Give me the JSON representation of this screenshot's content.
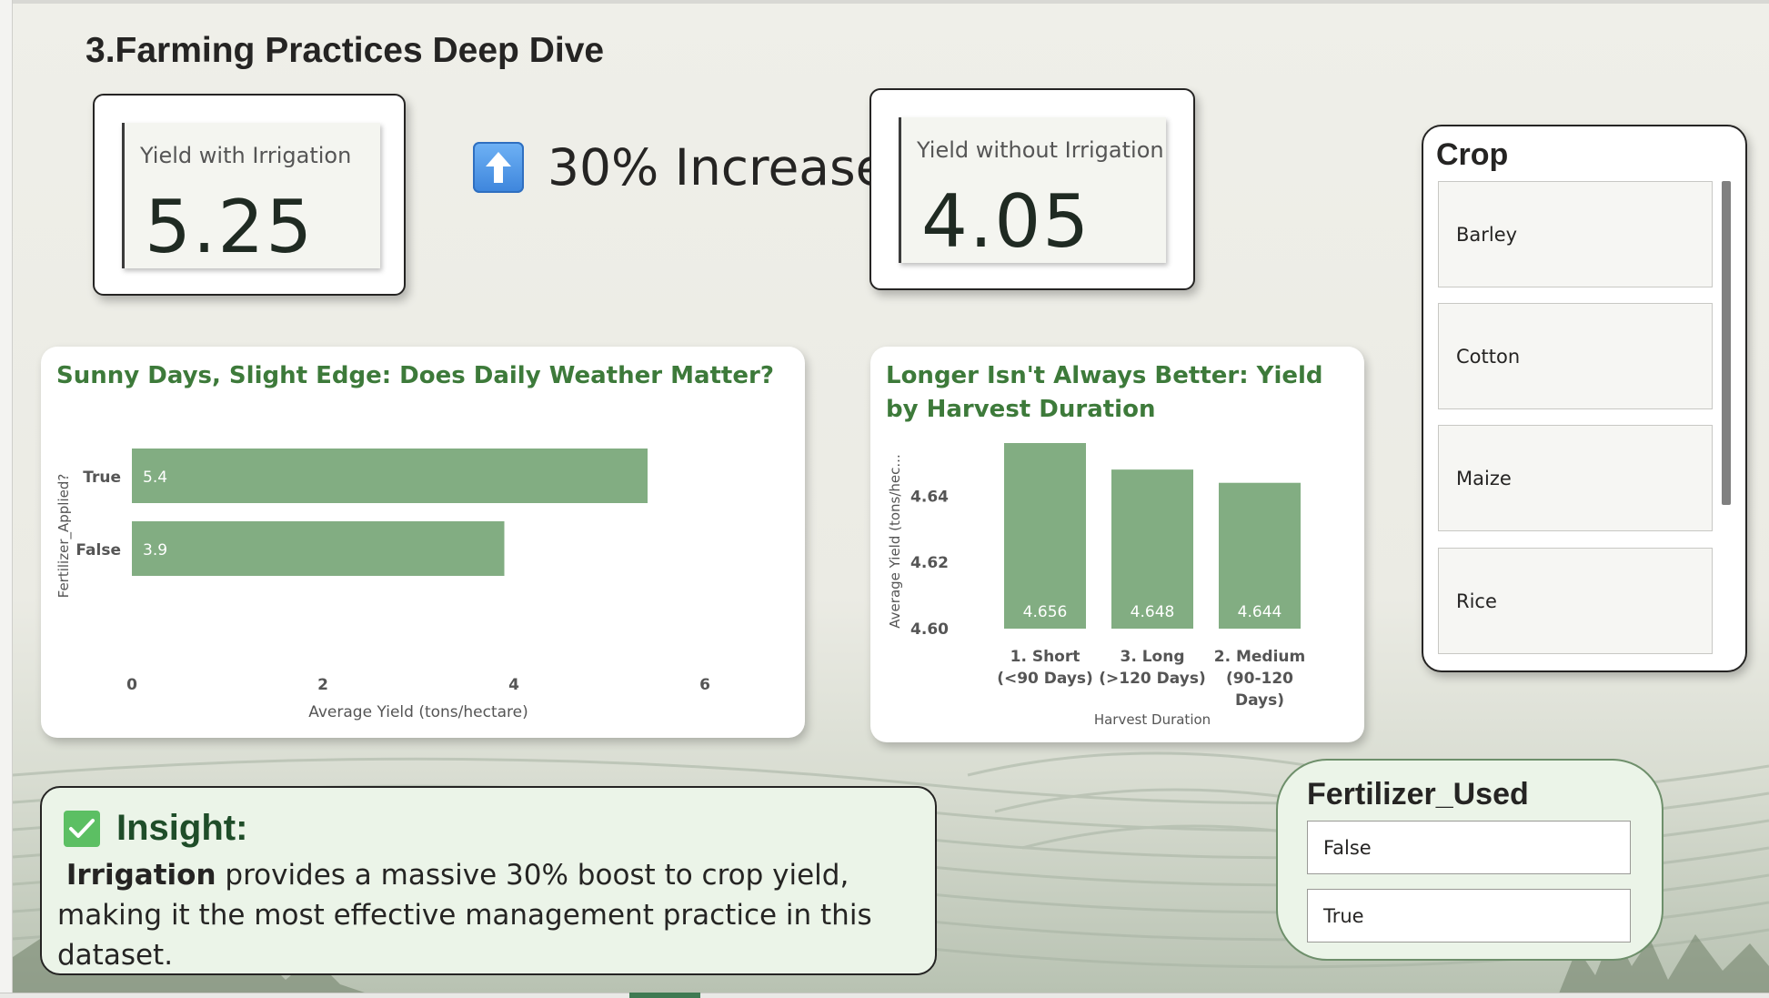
{
  "page": {
    "title": "3.Farming Practices Deep Dive"
  },
  "kpis": {
    "with_irrigation": {
      "label": "Yield with Irrigation",
      "value": "5.25"
    },
    "without_irrigation": {
      "label": "Yield without Irrigation",
      "value": "4.05"
    },
    "increase": {
      "text": "30% Increase",
      "icon": "up-arrow-icon"
    }
  },
  "chart_data": [
    {
      "type": "bar",
      "orientation": "horizontal",
      "title": "Sunny Days, Slight Edge: Does Daily Weather Matter?",
      "xlabel": "Average Yield (tons/hectare)",
      "ylabel": "Fertilizer_Applied?",
      "categories": [
        "True",
        "False"
      ],
      "values": [
        5.4,
        3.9
      ],
      "data_labels": [
        "5.4",
        "3.9"
      ],
      "xlim": [
        0,
        6
      ],
      "xticks": [
        "0",
        "2",
        "4",
        "6"
      ],
      "bar_color": "#82ad82"
    },
    {
      "type": "bar",
      "orientation": "vertical",
      "title": "Longer Isn't Always Better: Yield by Harvest Duration",
      "xlabel": "Harvest Duration",
      "ylabel": "Average Yield (tons/hec...",
      "categories": [
        "1. Short (<90 Days)",
        "3. Long (>120 Days)",
        "2. Medium (90-120 Days)"
      ],
      "category_lines": [
        [
          "1. Short",
          "(<90 Days)"
        ],
        [
          "3. Long",
          "(>120 Days)"
        ],
        [
          "2. Medium",
          "(90-120",
          "Days)"
        ]
      ],
      "values": [
        4.656,
        4.648,
        4.644
      ],
      "data_labels": [
        "4.656",
        "4.648",
        "4.644"
      ],
      "ylim": [
        4.6,
        4.656
      ],
      "yticks": [
        "4.64",
        "4.62",
        "4.60"
      ],
      "bar_color": "#82ad82"
    }
  ],
  "crop_slicer": {
    "title": "Crop",
    "items": [
      "Barley",
      "Cotton",
      "Maize",
      "Rice"
    ]
  },
  "fertilizer_slicer": {
    "title": "Fertilizer_Used",
    "items": [
      "False",
      "True"
    ]
  },
  "insight": {
    "title": "Insight:",
    "icon": "check-icon",
    "bold": "Irrigation",
    "text": " provides a massive 30% boost to crop yield, making it the most effective management practice in this dataset."
  }
}
